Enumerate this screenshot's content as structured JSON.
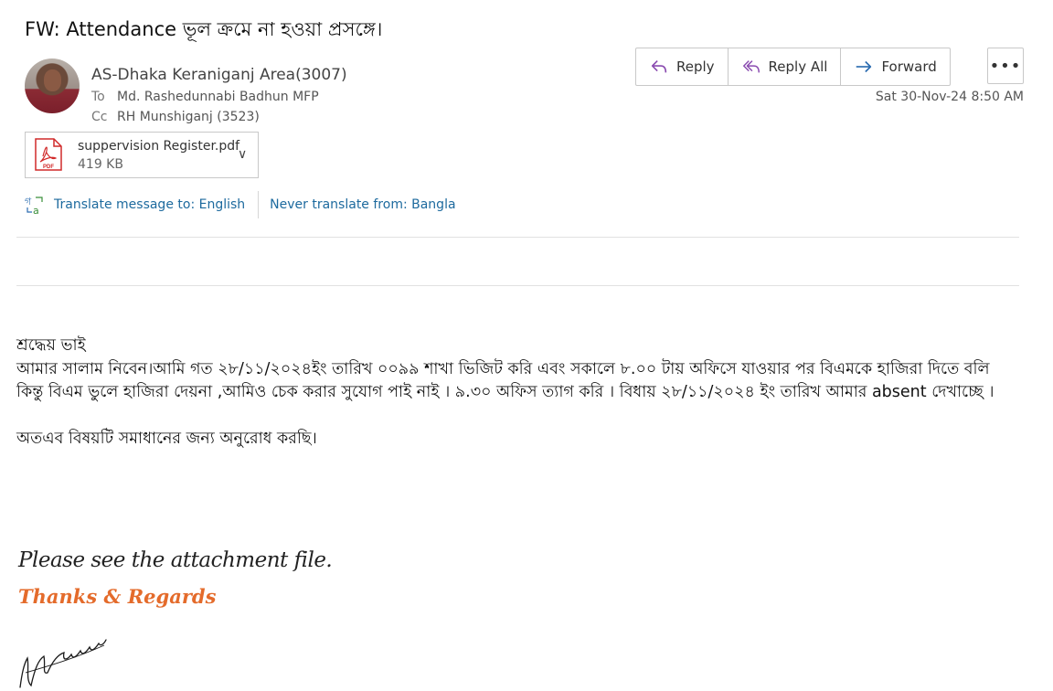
{
  "email": {
    "subject": "FW: Attendance ভূল ক্রমে না হওয়া প্রসঙ্গে।",
    "sender": "AS-Dhaka Keraniganj Area(3007)",
    "to_label": "To",
    "to": "Md. Rashedunnabi Badhun MFP",
    "cc_label": "Cc",
    "cc": "RH Munshiganj (3523)",
    "date": "Sat 30-Nov-24 8:50 AM"
  },
  "toolbar": {
    "reply": "Reply",
    "reply_all": "Reply All",
    "forward": "Forward",
    "more": "•••"
  },
  "attachment": {
    "name": "suppervision Register.pdf",
    "size": "419 KB",
    "icon_text": "PDF"
  },
  "translate": {
    "translate_link": "Translate message to: English",
    "never_link": "Never translate from: Bangla"
  },
  "body": {
    "greeting": "শ্রদ্ধেয় ভাই",
    "para1": "আমার সালাম নিবেন।আমি গত ২৮/১১/২০২৪ইং তারিখ ০০৯৯ শাখা ভিজিট করি এবং সকালে ৮.০০ টায়  অফিসে যাওয়ার পর বিএমকে হাজিরা দিতে বলি",
    "para2": "কিন্তু বিএম ভুলে হাজিরা দেয়না ,আমিও চেক করার সুযোগ পাই নাই । ৯.৩০ অফিস ত্যাগ করি । বিধায় ২৮/১১/২০২৪ ইং তারিখ আমার absent দেখাচ্ছে ।",
    "para3": "অতএব বিষয়টি সমাধানের জন্য অনুরোধ করছি।"
  },
  "signature": {
    "see_attachment": "Please see the attachment file.",
    "thanks": "Thanks & Regards"
  },
  "colors": {
    "link": "#1d6a9e",
    "reply_icon": "#8a4bb0",
    "forward_icon": "#2b6cb0",
    "thanks": "#e46b2b",
    "pdf_red": "#d12a2a"
  }
}
